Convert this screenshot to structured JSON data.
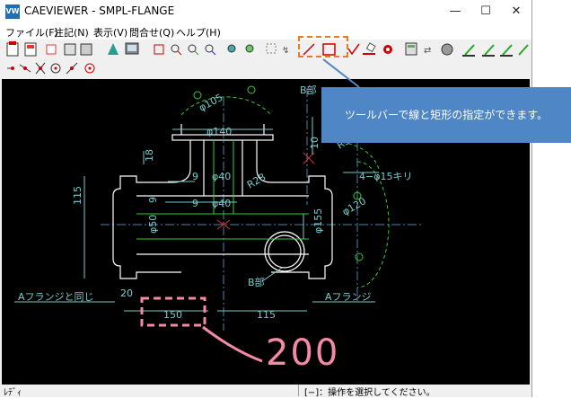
{
  "window": {
    "title": "CAEVIEWER - SMPL-FLANGE",
    "app_icon_text": "VW",
    "controls": {
      "minimize": "—",
      "maximize": "☐",
      "close": "✕"
    }
  },
  "menu": [
    "ファイル(F)",
    "注記(N)",
    "表示(V)",
    "問合せ(Q)",
    "ヘルプ(H)"
  ],
  "drawing": {
    "dim_phi105": "φ105",
    "dim_phi140": "φ140",
    "dim_18": "18",
    "dim_10": "10",
    "dim_R5": "R5",
    "dim_B": "B部",
    "dim_9a": "9",
    "dim_phi40a": "φ40",
    "dim_R28": "R28",
    "dim_9b": "9",
    "dim_phi40b": "φ40",
    "dim_115v": "115",
    "dim_9c": "9",
    "dim_phi50": "φ50",
    "dim_phi155": "φ155",
    "dim_4holes": "4−φ15キリ",
    "dim_phi120": "φ120",
    "dim_Bpart": "B部",
    "label_A_same": "Aフランジと同じ",
    "label_A_flange": "Aフランジ",
    "dim_20": "20",
    "dim_150": "150",
    "dim_115h": "115"
  },
  "annotation": {
    "tooltip": "ツールバーで線と矩形の指定ができます。",
    "handwritten": "200",
    "colors": {
      "tooltip_bg": "#4f86c6",
      "highlight": "#f07a20",
      "pen": "#f48aa6"
    }
  },
  "status": {
    "left": "ﾚﾃﾞｨ",
    "right": "[−]：操作を選択してください。"
  }
}
